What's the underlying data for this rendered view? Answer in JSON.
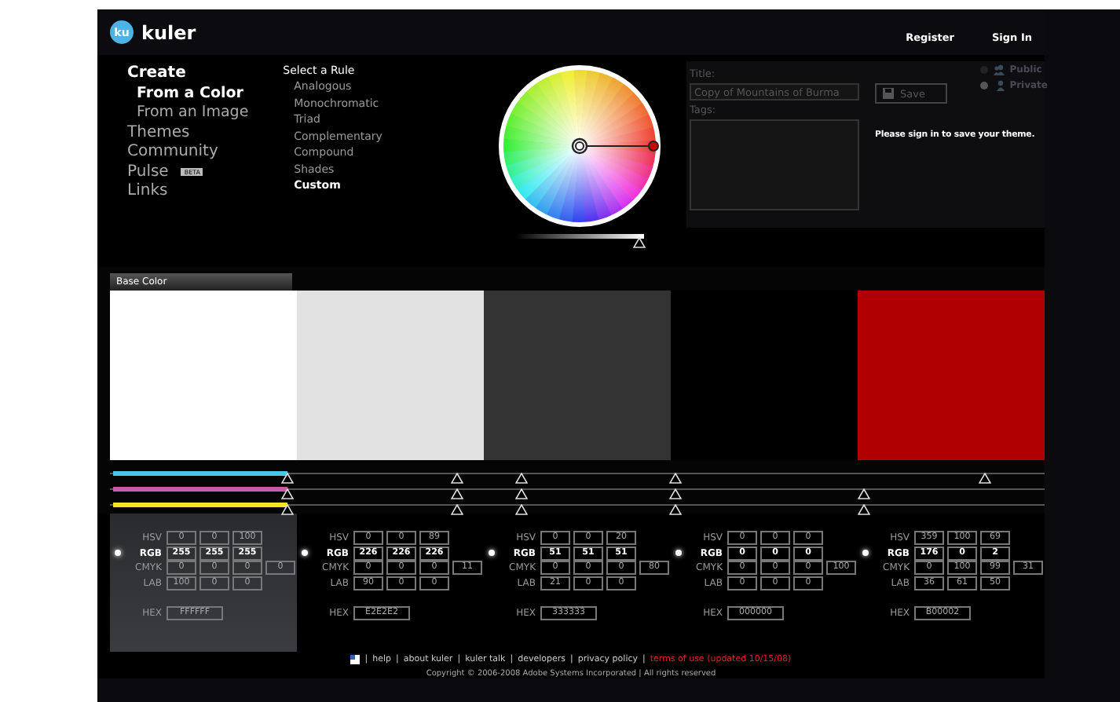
{
  "header": {
    "logo_badge": "ku",
    "logo_text": "kuler",
    "links": [
      "Register",
      "Sign In"
    ]
  },
  "nav": [
    {
      "label": "Create",
      "selected": true,
      "children": [
        {
          "label": "From a Color",
          "selected": true
        },
        {
          "label": "From an Image",
          "selected": false
        }
      ]
    },
    {
      "label": "Themes",
      "selected": false
    },
    {
      "label": "Community",
      "selected": false
    },
    {
      "label": "Pulse",
      "selected": false,
      "badge": "BETA"
    },
    {
      "label": "Links",
      "selected": false
    }
  ],
  "rules": {
    "title": "Select a Rule",
    "items": [
      {
        "label": "Analogous",
        "selected": false
      },
      {
        "label": "Monochromatic",
        "selected": false
      },
      {
        "label": "Triad",
        "selected": false
      },
      {
        "label": "Complementary",
        "selected": false
      },
      {
        "label": "Compound",
        "selected": false
      },
      {
        "label": "Shades",
        "selected": false
      },
      {
        "label": "Custom",
        "selected": true
      }
    ]
  },
  "wheel": {
    "brightness": {
      "level": 0.97
    }
  },
  "save_form": {
    "title_label": "Title:",
    "title_value": "Copy of Mountains of Burma",
    "tags_label": "Tags:",
    "save_button": "Save",
    "visibility": [
      {
        "label": "Public",
        "selected": false
      },
      {
        "label": "Private",
        "selected": true
      }
    ],
    "message": "Please sign in to save your theme."
  },
  "base_color_tab": "Base Color",
  "swatches": [
    {
      "color": "#ffffff"
    },
    {
      "color": "#e2e2e2"
    },
    {
      "color": "#333333"
    },
    {
      "color": "#000000"
    },
    {
      "color": "#b00002"
    }
  ],
  "sliders": [
    {
      "color": "#49c8e6",
      "markers": [
        {
          "level": 0.19
        },
        {
          "level": 0.371
        },
        {
          "level": 0.44
        },
        {
          "level": 0.605
        },
        {
          "level": 0.936
        }
      ]
    },
    {
      "color": "#c45aa8",
      "markers": [
        {
          "level": 0.19
        },
        {
          "level": 0.371
        },
        {
          "level": 0.44
        },
        {
          "level": 0.605
        },
        {
          "level": 0.806
        }
      ]
    },
    {
      "color": "#f2e526",
      "markers": [
        {
          "level": 0.19
        },
        {
          "level": 0.371
        },
        {
          "level": 0.44
        },
        {
          "level": 0.605
        },
        {
          "level": 0.806
        }
      ]
    }
  ],
  "color_values": [
    {
      "selected": true,
      "rows": [
        {
          "label": "HSV",
          "values": [
            "0",
            "0",
            "100"
          ]
        },
        {
          "label": "RGB",
          "values": [
            "255",
            "255",
            "255"
          ]
        },
        {
          "label": "CMYK",
          "values": [
            "0",
            "0",
            "0",
            "0"
          ]
        },
        {
          "label": "LAB",
          "values": [
            "100",
            "0",
            "0"
          ]
        }
      ],
      "hex_label": "HEX",
      "hex": "FFFFFF"
    },
    {
      "selected": false,
      "rows": [
        {
          "label": "HSV",
          "values": [
            "0",
            "0",
            "89"
          ]
        },
        {
          "label": "RGB",
          "values": [
            "226",
            "226",
            "226"
          ]
        },
        {
          "label": "CMYK",
          "values": [
            "0",
            "0",
            "0",
            "11"
          ]
        },
        {
          "label": "LAB",
          "values": [
            "90",
            "0",
            "0"
          ]
        }
      ],
      "hex_label": "HEX",
      "hex": "E2E2E2"
    },
    {
      "selected": false,
      "rows": [
        {
          "label": "HSV",
          "values": [
            "0",
            "0",
            "20"
          ]
        },
        {
          "label": "RGB",
          "values": [
            "51",
            "51",
            "51"
          ]
        },
        {
          "label": "CMYK",
          "values": [
            "0",
            "0",
            "0",
            "80"
          ]
        },
        {
          "label": "LAB",
          "values": [
            "21",
            "0",
            "0"
          ]
        }
      ],
      "hex_label": "HEX",
      "hex": "333333"
    },
    {
      "selected": false,
      "rows": [
        {
          "label": "HSV",
          "values": [
            "0",
            "0",
            "0"
          ]
        },
        {
          "label": "RGB",
          "values": [
            "0",
            "0",
            "0"
          ]
        },
        {
          "label": "CMYK",
          "values": [
            "0",
            "0",
            "0",
            "100"
          ]
        },
        {
          "label": "LAB",
          "values": [
            "0",
            "0",
            "0"
          ]
        }
      ],
      "hex_label": "HEX",
      "hex": "000000"
    },
    {
      "selected": false,
      "rows": [
        {
          "label": "HSV",
          "values": [
            "359",
            "100",
            "69"
          ]
        },
        {
          "label": "RGB",
          "values": [
            "176",
            "0",
            "2"
          ]
        },
        {
          "label": "CMYK",
          "values": [
            "0",
            "100",
            "99",
            "31"
          ]
        },
        {
          "label": "LAB",
          "values": [
            "36",
            "61",
            "50"
          ]
        }
      ],
      "hex_label": "HEX",
      "hex": "B00002"
    }
  ],
  "footer": {
    "links": [
      {
        "label": "help",
        "kind": "normal"
      },
      {
        "label": "about kuler",
        "kind": "normal"
      },
      {
        "label": "kuler talk",
        "kind": "normal"
      },
      {
        "label": "developers",
        "kind": "normal"
      },
      {
        "label": "privacy policy",
        "kind": "normal"
      },
      {
        "label": "terms of use (updated 10/15/08)",
        "kind": "alert"
      }
    ],
    "separator": "|",
    "copyright": "Copyright © 2006-2008 Adobe Systems Incorporated | All rights reserved"
  }
}
